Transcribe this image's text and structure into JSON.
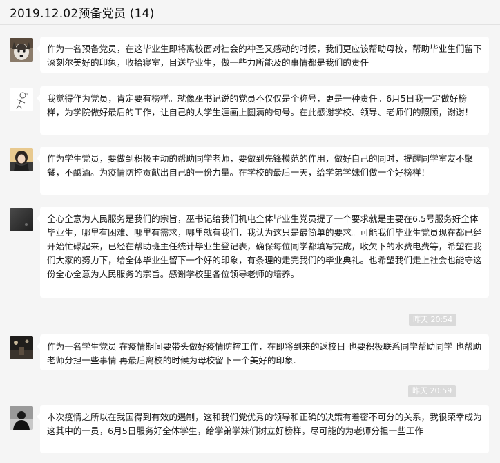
{
  "window": {
    "title": "2019.12.02预备党员 (14)"
  },
  "messages": [
    {
      "avatar": "husky-avatar-icon",
      "text": "作为一名预备党员，在这毕业生即将离校面对社会的神圣又感动的时候，我们更应该帮助母校，帮助毕业生们留下深刻尔美好的印象，收拾寝室，目送毕业生，做一些力所能及的事情都是我们的责任"
    },
    {
      "avatar": "sketch-avatar-icon",
      "text": "我觉得作为党员，肯定要有榜样。就像巫书记说的党员不仅仅是个称号，更是一种责任。6月5日我一定做好榜样，为学院做好最后的工作，让自己的大学生涯画上圆满的句号。在此感谢学校、领导、老师们的照顾，谢谢！"
    },
    {
      "avatar": "girl-avatar-icon",
      "text": "作为学生党员，要做到积极主动的帮助同学老师，要做到先锋模范的作用，做好自己的同时，提醒同学室友不聚餐，不酗酒。为疫情防控贡献出自己的一份力量。在学校的最后一天，给学弟学妹们做一个好榜样！"
    },
    {
      "avatar": "dark-avatar-icon",
      "text": "全心全意为人民服务是我们的宗旨，巫书记给我们机电全体毕业生党员提了一个要求就是主要在6.5号服务好全体毕业生，哪里有困难、哪里有需求，哪里就有我们，我认为这只是最简单的要求。可能我们毕业生党员现在都已经开始忙碌起来，已经在帮助班主任统计毕业生登记表，确保每位同学都填写完成，收欠下的水费电费等，希望在我们大家的努力下，给全体毕业生留下一个好的印象，有条理的走完我们的毕业典礼。也希望我们走上社会也能守这份全心全意为人民服务的宗旨。感谢学校里各位领导老师的培养。"
    },
    {
      "timestamp": "昨天 20:54"
    },
    {
      "avatar": "night-avatar-icon",
      "text": "作为一名学生党员 在疫情期间要带头做好疫情防控工作，在即将到来的返校日 也要积极联系同学帮助同学 也帮助老师分担一些事情 再最后离校的时候为母校留下一个美好的印象."
    },
    {
      "timestamp": "昨天 20:59"
    },
    {
      "avatar": "silhouette-avatar-icon",
      "text": "本次疫情之所以在我国得到有效的遏制，这和我们党优秀的领导和正确的决策有着密不可分的关系，我很荣幸成为这其中的一员，6月5日服务好全体学生，给学弟学妹们树立好榜样，尽可能的为老师分担一些工作"
    }
  ],
  "colors": {
    "background": "#f5f5f5",
    "bubble": "#ffffff",
    "timestamp_bg": "#dadada"
  }
}
